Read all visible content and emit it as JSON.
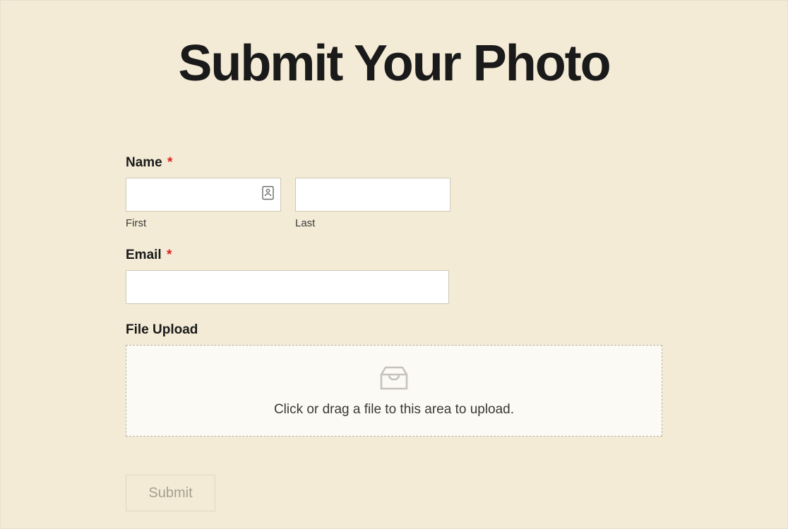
{
  "heading": "Submit Your Photo",
  "form": {
    "name": {
      "label": "Name",
      "required_marker": "*",
      "first": {
        "sublabel": "First",
        "value": ""
      },
      "last": {
        "sublabel": "Last",
        "value": ""
      }
    },
    "email": {
      "label": "Email",
      "required_marker": "*",
      "value": ""
    },
    "file_upload": {
      "label": "File Upload",
      "dropzone_text": "Click or drag a file to this area to upload."
    },
    "submit_label": "Submit"
  }
}
